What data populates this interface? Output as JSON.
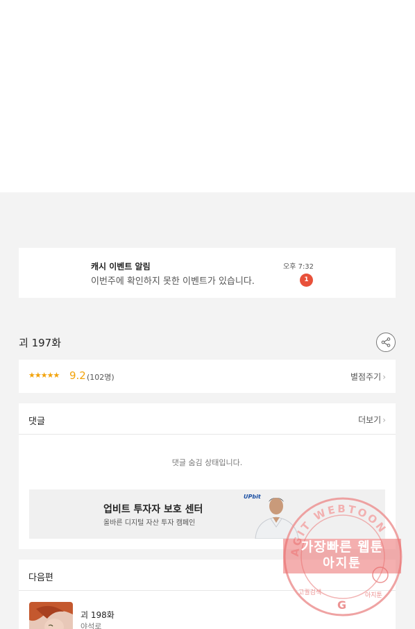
{
  "notification": {
    "title": "캐시 이벤트 알림",
    "message": "이번주에 확인하지 못한 이벤트가 있습니다.",
    "time": "오후 7:32",
    "badge_count": "1"
  },
  "episode": {
    "title": "괴 197화"
  },
  "rating": {
    "stars": "★★★★★",
    "score": "9.2",
    "votes": "(102명)",
    "rate_label": "별점주기"
  },
  "comments": {
    "label": "댓글",
    "more_label": "더보기",
    "hidden_message": "댓글 숨김 상태입니다."
  },
  "ad": {
    "logo": "UPbit",
    "title": "업비트 투자자 보호 센터",
    "subtitle": "올바른 디지털 자산 투자 캠페인"
  },
  "next": {
    "label": "다음편",
    "episode": "괴 198화",
    "author": "야석로"
  },
  "watermark": {
    "ring_text": "AGIT WEBTOON",
    "line1": "가장빠른 웹툰",
    "line2": "아지툰",
    "bottom_left": "고퀄검색",
    "bottom_right": "아지툰"
  },
  "colors": {
    "accent_orange": "#f2a30b",
    "badge_red": "#e8513a",
    "watermark_red": "#e86a6a",
    "background": "#f3f3f3"
  }
}
